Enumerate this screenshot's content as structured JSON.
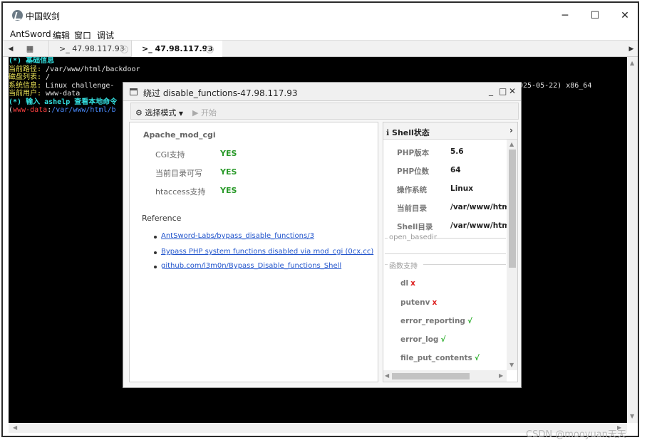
{
  "window": {
    "title": "中国蚁剑",
    "minimize": "─",
    "maximize": "☐",
    "close": "✕"
  },
  "menu": [
    "AntSword",
    "编辑",
    "窗口",
    "调试"
  ],
  "tabs": {
    "grid_icon": "grid-icon",
    "items": [
      {
        "label": ">_ 47.98.117.93",
        "active": false
      },
      {
        "label": ">_ 47.98.117.93",
        "active": true
      }
    ],
    "close_glyph": "✕"
  },
  "terminal": {
    "line1": "(*) 基础信息",
    "path_label": "当前路径:",
    "path_value": " /var/www/html/backdoor",
    "disk_label": "磁盘列表:",
    "disk_value": " /",
    "sys_label": "系统信息:",
    "sys_value": " Linux challenge-",
    "sys_tail": "025-05-22) x86_64",
    "user_label": "当前用户:",
    "user_value": " www-data",
    "help_line": "(*) 输入 ashelp 查看本地命令",
    "prompt_open": "(",
    "prompt_user": "www-data",
    "prompt_colon": ":",
    "prompt_path": "/var/www/html/b"
  },
  "dialog": {
    "title": "绕过 disable_functions-47.98.117.93",
    "controls": {
      "minimize": "_",
      "maximize": "□",
      "close": "✕"
    },
    "toolbar": {
      "mode_label": "选择模式",
      "start_label": "开始"
    },
    "left": {
      "heading": "Apache_mod_cgi",
      "rows": [
        {
          "label": "CGI支持",
          "value": "YES"
        },
        {
          "label": "当前目录可写",
          "value": "YES"
        },
        {
          "label": "htaccess支持",
          "value": "YES"
        }
      ],
      "reference_title": "Reference",
      "links": [
        "AntSword-Labs/bypass_disable_functions/3",
        "Bypass PHP system functions disabled via mod_cgi (0cx.cc)",
        "github.com/l3m0n/Bypass_Disable_functions_Shell"
      ]
    },
    "right": {
      "header": "Shell状态",
      "info_rows": [
        {
          "key": "PHP版本",
          "value": "5.6"
        },
        {
          "key": "PHP位数",
          "value": "64"
        },
        {
          "key": "操作系统",
          "value": "Linux"
        },
        {
          "key": "当前目录",
          "value": "/var/www/html/backdoor"
        },
        {
          "key": "Shell目录",
          "value": "/var/www/html/backdoor"
        }
      ],
      "open_basedir_label": "open_basedir",
      "functions_label": "函数支持",
      "functions": [
        {
          "name": "dl",
          "mark": "x",
          "supported": false
        },
        {
          "name": "putenv",
          "mark": "x",
          "supported": false
        },
        {
          "name": "error_reporting",
          "mark": "√",
          "supported": true
        },
        {
          "name": "error_log",
          "mark": "√",
          "supported": true
        },
        {
          "name": "file_put_contents",
          "mark": "√",
          "supported": true
        }
      ]
    }
  },
  "watermark": "CSDN @mooyuan天天"
}
